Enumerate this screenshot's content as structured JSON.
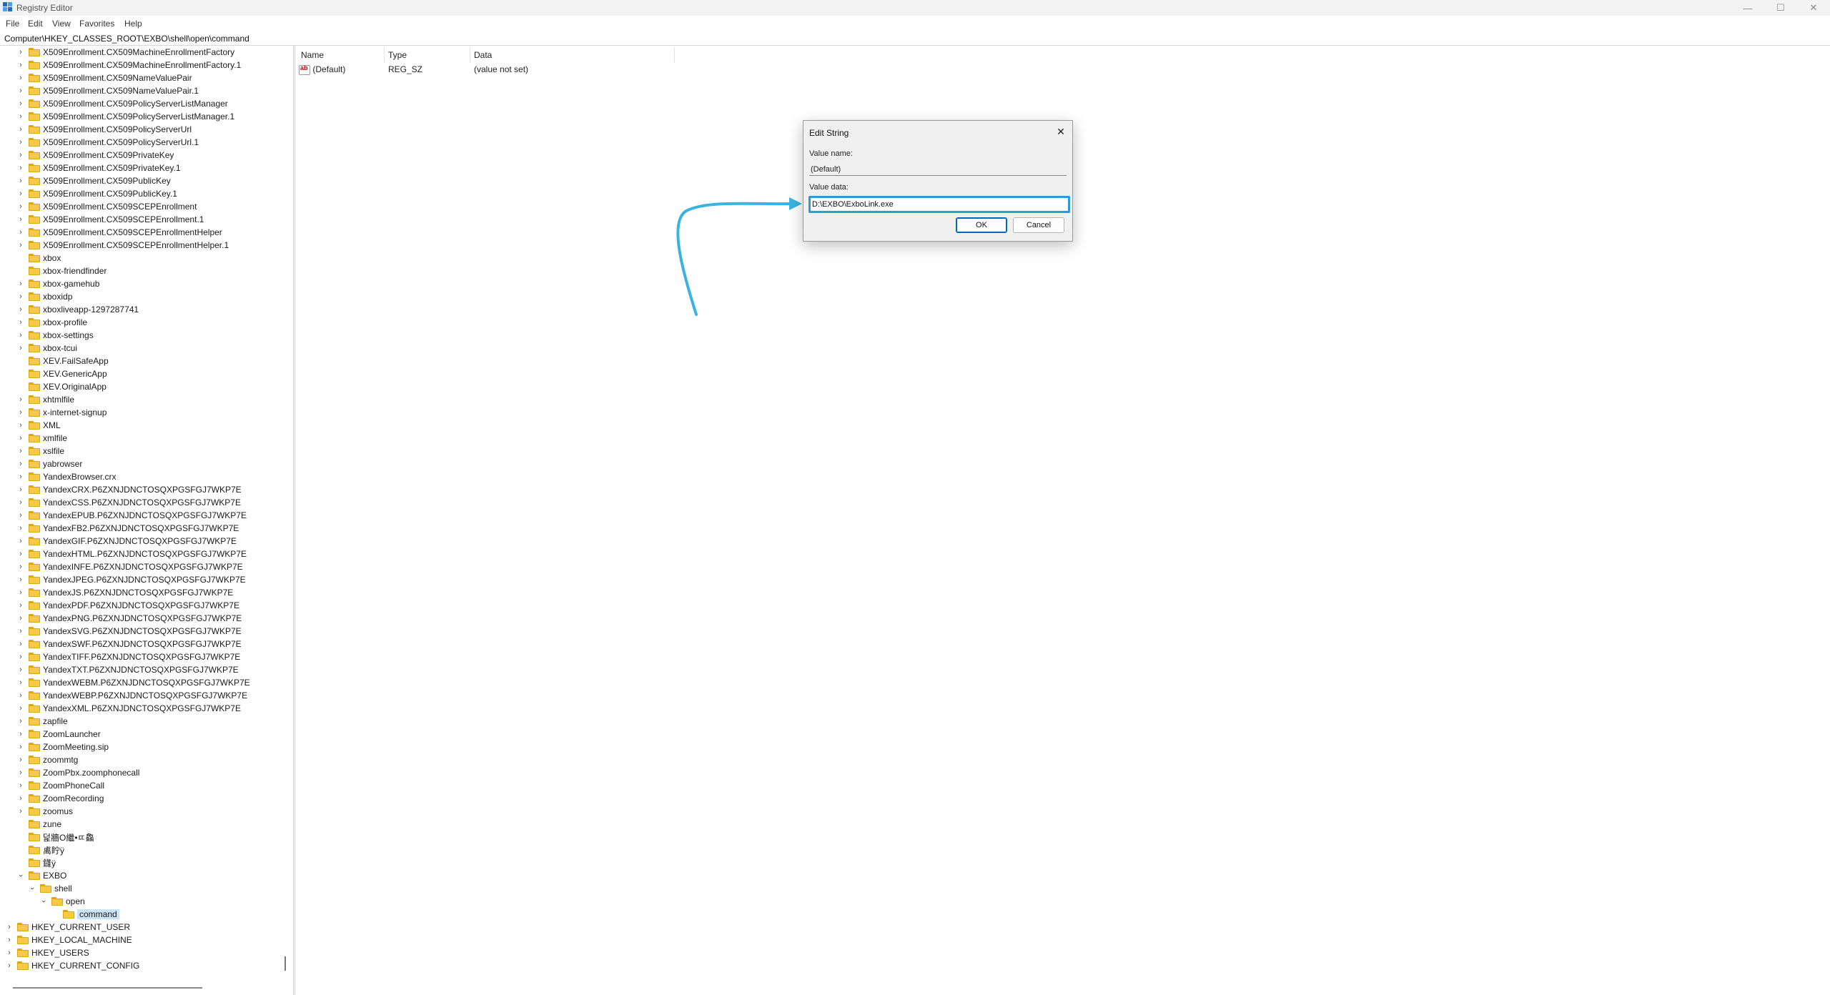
{
  "window": {
    "title": "Registry Editor",
    "controls": {
      "minimize": "—",
      "maximize": "☐",
      "close": "✕"
    }
  },
  "menu": [
    "File",
    "Edit",
    "View",
    "Favorites",
    "Help"
  ],
  "address": "Computer\\HKEY_CLASSES_ROOT\\EXBO\\shell\\open\\command",
  "tree": [
    {
      "label": "X509Enrollment.CX509MachineEnrollmentFactory",
      "level": 2,
      "expander": "collapsed"
    },
    {
      "label": "X509Enrollment.CX509MachineEnrollmentFactory.1",
      "level": 2,
      "expander": "collapsed"
    },
    {
      "label": "X509Enrollment.CX509NameValuePair",
      "level": 2,
      "expander": "collapsed"
    },
    {
      "label": "X509Enrollment.CX509NameValuePair.1",
      "level": 2,
      "expander": "collapsed"
    },
    {
      "label": "X509Enrollment.CX509PolicyServerListManager",
      "level": 2,
      "expander": "collapsed"
    },
    {
      "label": "X509Enrollment.CX509PolicyServerListManager.1",
      "level": 2,
      "expander": "collapsed"
    },
    {
      "label": "X509Enrollment.CX509PolicyServerUrl",
      "level": 2,
      "expander": "collapsed"
    },
    {
      "label": "X509Enrollment.CX509PolicyServerUrl.1",
      "level": 2,
      "expander": "collapsed"
    },
    {
      "label": "X509Enrollment.CX509PrivateKey",
      "level": 2,
      "expander": "collapsed"
    },
    {
      "label": "X509Enrollment.CX509PrivateKey.1",
      "level": 2,
      "expander": "collapsed"
    },
    {
      "label": "X509Enrollment.CX509PublicKey",
      "level": 2,
      "expander": "collapsed"
    },
    {
      "label": "X509Enrollment.CX509PublicKey.1",
      "level": 2,
      "expander": "collapsed"
    },
    {
      "label": "X509Enrollment.CX509SCEPEnrollment",
      "level": 2,
      "expander": "collapsed"
    },
    {
      "label": "X509Enrollment.CX509SCEPEnrollment.1",
      "level": 2,
      "expander": "collapsed"
    },
    {
      "label": "X509Enrollment.CX509SCEPEnrollmentHelper",
      "level": 2,
      "expander": "collapsed"
    },
    {
      "label": "X509Enrollment.CX509SCEPEnrollmentHelper.1",
      "level": 2,
      "expander": "collapsed"
    },
    {
      "label": "xbox",
      "level": 2,
      "expander": "none"
    },
    {
      "label": "xbox-friendfinder",
      "level": 2,
      "expander": "none"
    },
    {
      "label": "xbox-gamehub",
      "level": 2,
      "expander": "collapsed"
    },
    {
      "label": "xboxidp",
      "level": 2,
      "expander": "collapsed"
    },
    {
      "label": "xboxliveapp-1297287741",
      "level": 2,
      "expander": "collapsed"
    },
    {
      "label": "xbox-profile",
      "level": 2,
      "expander": "collapsed"
    },
    {
      "label": "xbox-settings",
      "level": 2,
      "expander": "collapsed"
    },
    {
      "label": "xbox-tcui",
      "level": 2,
      "expander": "collapsed"
    },
    {
      "label": "XEV.FailSafeApp",
      "level": 2,
      "expander": "none"
    },
    {
      "label": "XEV.GenericApp",
      "level": 2,
      "expander": "none"
    },
    {
      "label": "XEV.OriginalApp",
      "level": 2,
      "expander": "none"
    },
    {
      "label": "xhtmlfile",
      "level": 2,
      "expander": "collapsed"
    },
    {
      "label": "x-internet-signup",
      "level": 2,
      "expander": "collapsed"
    },
    {
      "label": "XML",
      "level": 2,
      "expander": "collapsed"
    },
    {
      "label": "xmlfile",
      "level": 2,
      "expander": "collapsed"
    },
    {
      "label": "xslfile",
      "level": 2,
      "expander": "collapsed"
    },
    {
      "label": "yabrowser",
      "level": 2,
      "expander": "collapsed"
    },
    {
      "label": "YandexBrowser.crx",
      "level": 2,
      "expander": "collapsed"
    },
    {
      "label": "YandexCRX.P6ZXNJDNCTOSQXPGSFGJ7WKP7E",
      "level": 2,
      "expander": "collapsed"
    },
    {
      "label": "YandexCSS.P6ZXNJDNCTOSQXPGSFGJ7WKP7E",
      "level": 2,
      "expander": "collapsed"
    },
    {
      "label": "YandexEPUB.P6ZXNJDNCTOSQXPGSFGJ7WKP7E",
      "level": 2,
      "expander": "collapsed"
    },
    {
      "label": "YandexFB2.P6ZXNJDNCTOSQXPGSFGJ7WKP7E",
      "level": 2,
      "expander": "collapsed"
    },
    {
      "label": "YandexGIF.P6ZXNJDNCTOSQXPGSFGJ7WKP7E",
      "level": 2,
      "expander": "collapsed"
    },
    {
      "label": "YandexHTML.P6ZXNJDNCTOSQXPGSFGJ7WKP7E",
      "level": 2,
      "expander": "collapsed"
    },
    {
      "label": "YandexINFE.P6ZXNJDNCTOSQXPGSFGJ7WKP7E",
      "level": 2,
      "expander": "collapsed"
    },
    {
      "label": "YandexJPEG.P6ZXNJDNCTOSQXPGSFGJ7WKP7E",
      "level": 2,
      "expander": "collapsed"
    },
    {
      "label": "YandexJS.P6ZXNJDNCTOSQXPGSFGJ7WKP7E",
      "level": 2,
      "expander": "collapsed"
    },
    {
      "label": "YandexPDF.P6ZXNJDNCTOSQXPGSFGJ7WKP7E",
      "level": 2,
      "expander": "collapsed"
    },
    {
      "label": "YandexPNG.P6ZXNJDNCTOSQXPGSFGJ7WKP7E",
      "level": 2,
      "expander": "collapsed"
    },
    {
      "label": "YandexSVG.P6ZXNJDNCTOSQXPGSFGJ7WKP7E",
      "level": 2,
      "expander": "collapsed"
    },
    {
      "label": "YandexSWF.P6ZXNJDNCTOSQXPGSFGJ7WKP7E",
      "level": 2,
      "expander": "collapsed"
    },
    {
      "label": "YandexTIFF.P6ZXNJDNCTOSQXPGSFGJ7WKP7E",
      "level": 2,
      "expander": "collapsed"
    },
    {
      "label": "YandexTXT.P6ZXNJDNCTOSQXPGSFGJ7WKP7E",
      "level": 2,
      "expander": "collapsed"
    },
    {
      "label": "YandexWEBM.P6ZXNJDNCTOSQXPGSFGJ7WKP7E",
      "level": 2,
      "expander": "collapsed"
    },
    {
      "label": "YandexWEBP.P6ZXNJDNCTOSQXPGSFGJ7WKP7E",
      "level": 2,
      "expander": "collapsed"
    },
    {
      "label": "YandexXML.P6ZXNJDNCTOSQXPGSFGJ7WKP7E",
      "level": 2,
      "expander": "collapsed"
    },
    {
      "label": "zapfile",
      "level": 2,
      "expander": "collapsed"
    },
    {
      "label": "ZoomLauncher",
      "level": 2,
      "expander": "collapsed"
    },
    {
      "label": "ZoomMeeting.sip",
      "level": 2,
      "expander": "collapsed"
    },
    {
      "label": "zoommtg",
      "level": 2,
      "expander": "collapsed"
    },
    {
      "label": "ZoomPbx.zoomphonecall",
      "level": 2,
      "expander": "collapsed"
    },
    {
      "label": "ZoomPhoneCall",
      "level": 2,
      "expander": "collapsed"
    },
    {
      "label": "ZoomRecording",
      "level": 2,
      "expander": "collapsed"
    },
    {
      "label": "zoomus",
      "level": 2,
      "expander": "collapsed"
    },
    {
      "label": "zune",
      "level": 2,
      "expander": "none"
    },
    {
      "label": "덡牆O繼•ㄸ鱻",
      "level": 2,
      "expander": "none"
    },
    {
      "label": "禼眝ÿ",
      "level": 2,
      "expander": "none"
    },
    {
      "label": "ٰ鑝ÿ",
      "level": 2,
      "expander": "none"
    },
    {
      "label": "EXBO",
      "level": 2,
      "expander": "expanded"
    },
    {
      "label": "shell",
      "level": 3,
      "expander": "expanded"
    },
    {
      "label": "open",
      "level": 4,
      "expander": "expanded"
    },
    {
      "label": "command",
      "level": 5,
      "expander": "none",
      "selected": true
    },
    {
      "label": "HKEY_CURRENT_USER",
      "level": 1,
      "expander": "collapsed"
    },
    {
      "label": "HKEY_LOCAL_MACHINE",
      "level": 1,
      "expander": "collapsed"
    },
    {
      "label": "HKEY_USERS",
      "level": 1,
      "expander": "collapsed"
    },
    {
      "label": "HKEY_CURRENT_CONFIG",
      "level": 1,
      "expander": "collapsed"
    }
  ],
  "list": {
    "columns": [
      "Name",
      "Type",
      "Data"
    ],
    "rows": [
      {
        "name": "(Default)",
        "type": "REG_SZ",
        "data": "(value not set)"
      }
    ]
  },
  "dialog": {
    "title": "Edit String",
    "close": "✕",
    "value_name_label": "Value name:",
    "value_name": "(Default)",
    "value_data_label": "Value data:",
    "value_data": "D:\\EXBO\\ExboLink.exe",
    "ok": "OK",
    "cancel": "Cancel"
  },
  "colors": {
    "highlight_arrow": "#3bb3e0",
    "input_focus": "#2e9bd6",
    "selection": "#cce4f7",
    "folder": "#f7c948"
  }
}
